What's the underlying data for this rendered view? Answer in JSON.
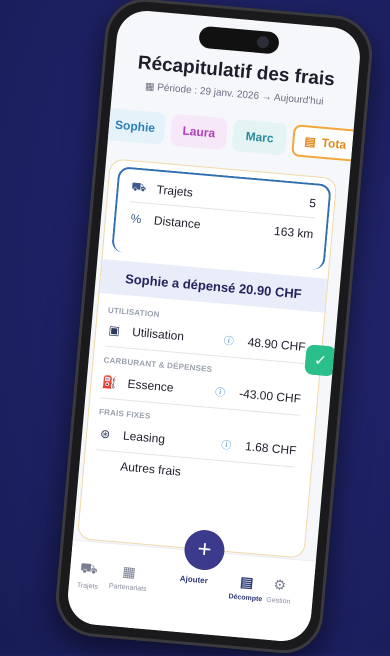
{
  "header": {
    "title": "Récapitulatif des frais",
    "period": "Période : 29 janv. 2026 → Aujourd'hui"
  },
  "tabs": [
    {
      "label": "Sophie"
    },
    {
      "label": "Laura"
    },
    {
      "label": "Marc"
    },
    {
      "label": "Tota"
    }
  ],
  "summary": {
    "trips_label": "Trajets",
    "trips_value": "5",
    "distance_label": "Distance",
    "distance_value": "163 km"
  },
  "banner": "Sophie a dépensé 20.90 CHF",
  "sections": {
    "utilisation": "UTILISATION",
    "fuel": "CARBURANT & DÉPENSES",
    "fixed": "FRAIS FIXES"
  },
  "items": {
    "utilisation": {
      "label": "Utilisation",
      "amount": "48.90 CHF"
    },
    "essence": {
      "label": "Essence",
      "amount": "-43.00 CHF"
    },
    "leasing": {
      "label": "Leasing",
      "amount": "1.68 CHF"
    },
    "autres": {
      "label": "Autres frais"
    }
  },
  "nav": {
    "trajets": "Trajets",
    "partenariats": "Partenariats",
    "ajouter": "Ajouter",
    "decompte": "Décompte",
    "gestion": "Gestion"
  },
  "colors": {
    "accent": "#3b3a8c",
    "check": "#2bbf8c",
    "total_border": "#f2a73a"
  }
}
